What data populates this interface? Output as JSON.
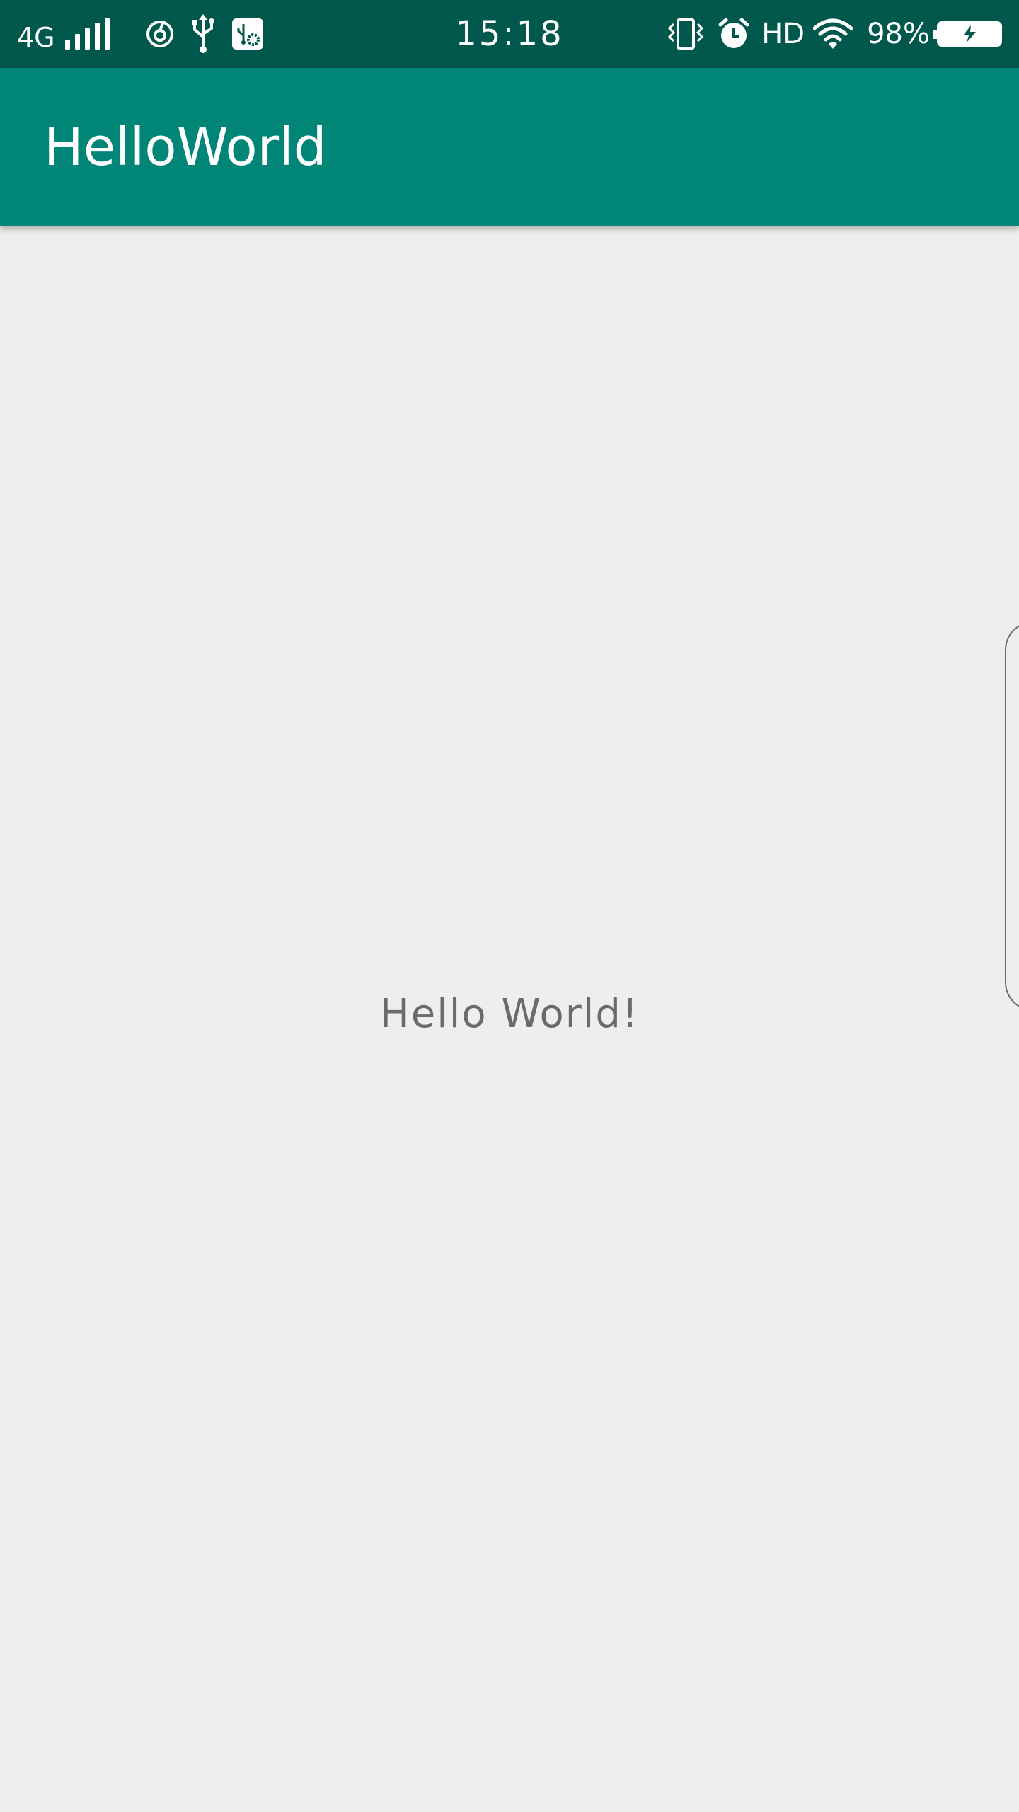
{
  "status_bar": {
    "network_type": "4G",
    "time": "15:18",
    "hd_label": "HD",
    "battery_percent": "98%",
    "icons": [
      "signal-icon",
      "netease-music-icon",
      "usb-icon",
      "usb-debug-icon",
      "vibrate-icon",
      "alarm-icon",
      "wifi-icon",
      "battery-charging-icon"
    ]
  },
  "app_bar": {
    "title": "HelloWorld",
    "color": "#008577"
  },
  "main": {
    "text": "Hello World!"
  },
  "colors": {
    "status_bar": "#00574B",
    "app_bar": "#008577",
    "background": "#EEEEEF",
    "text": "#6B6B6B"
  }
}
